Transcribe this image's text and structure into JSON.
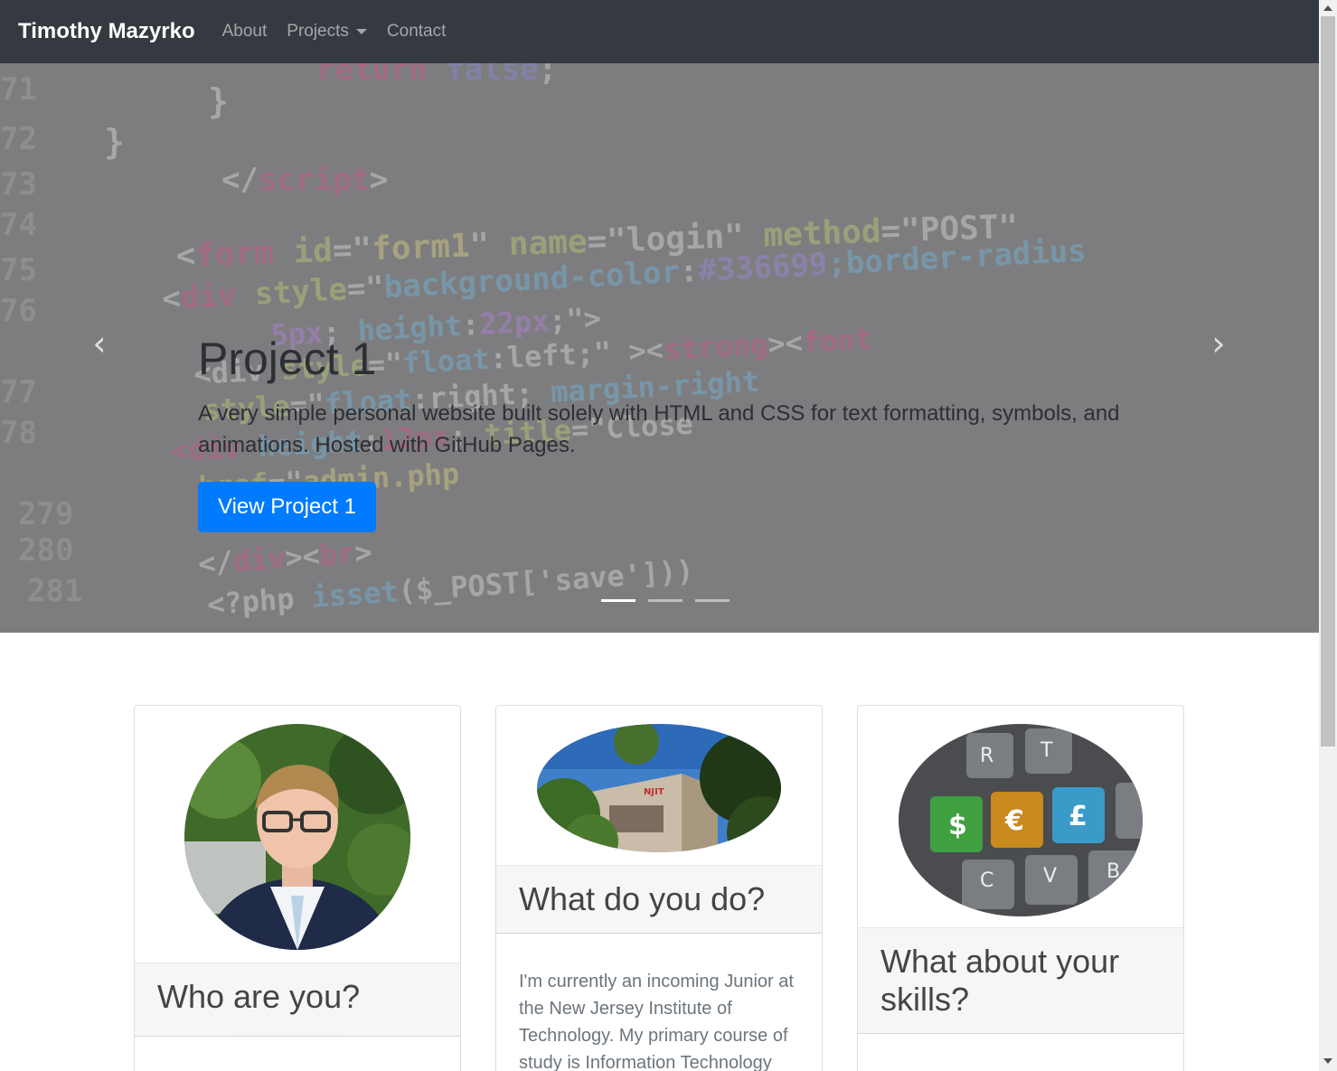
{
  "navbar": {
    "brand": "Timothy Mazyrko",
    "links": [
      {
        "label": "About"
      },
      {
        "label": "Projects",
        "dropdown": true
      },
      {
        "label": "Contact"
      }
    ]
  },
  "carousel": {
    "title": "Project 1",
    "description": "A very simple personal website built solely with HTML and CSS for text formatting, symbols, and animations. Hosted with GitHub Pages.",
    "button_label": "View Project 1",
    "prev_icon": "chevron-left-icon",
    "next_icon": "chevron-right-icon",
    "slide_count": 3,
    "active_slide": 1
  },
  "cards": [
    {
      "title": "Who are you?",
      "body": "",
      "image": "portrait-photo"
    },
    {
      "title": "What do you do?",
      "body": "I'm currently an incoming Junior at the New Jersey Institute of Technology. My primary course of study is Information Technology",
      "image": "campus-building-photo"
    },
    {
      "title": "What about your skills?",
      "body": "",
      "image": "currency-keyboard-photo"
    }
  ],
  "colors": {
    "navbar_bg": "#343a40",
    "primary": "#007bff"
  }
}
